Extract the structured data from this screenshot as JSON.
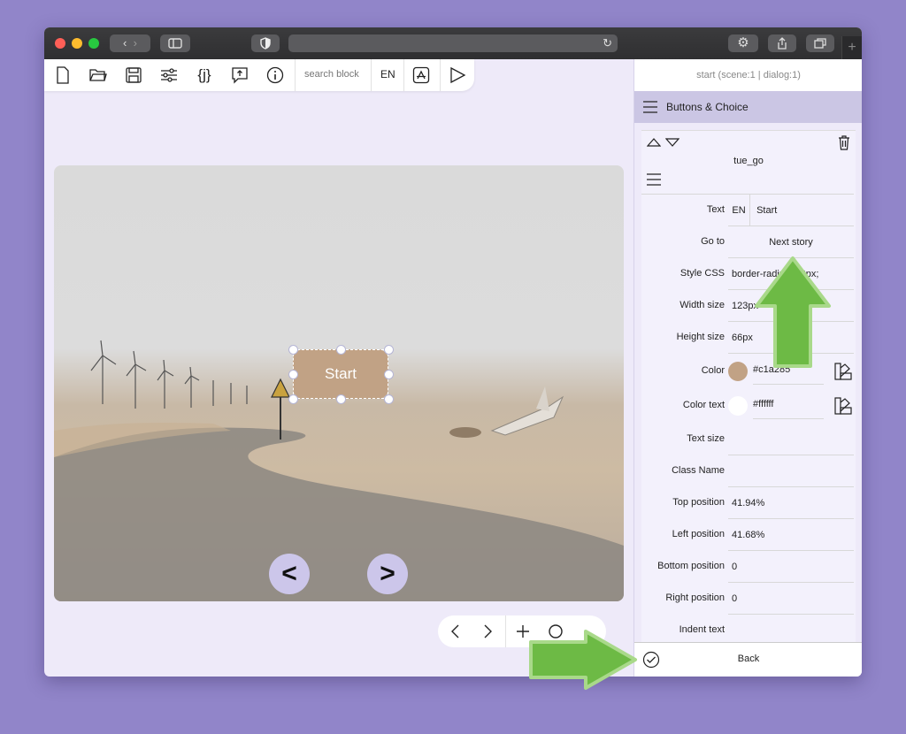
{
  "toolbar": {
    "search_placeholder": "search block",
    "language": "EN"
  },
  "scene": {
    "button_label": "Start",
    "prev_label": "<",
    "next_label": ">"
  },
  "panel": {
    "header": "start (scene:1 | dialog:1)",
    "section_title": "Buttons & Choice",
    "block_name": "tue_go",
    "back_label": "Back",
    "fields": {
      "text_label": "Text",
      "text_lang": "EN",
      "text_value": "Start",
      "goto_label": "Go to",
      "goto_value": "Next story",
      "style_label": "Style CSS",
      "style_value": "border-radius: 12px;",
      "width_label": "Width size",
      "width_value": "123px",
      "height_label": "Height size",
      "height_value": "66px",
      "color_label": "Color",
      "color_value": "#c1a285",
      "color_text_label": "Color text",
      "color_text_value": "#ffffff",
      "text_size_label": "Text size",
      "text_size_value": "",
      "class_label": "Class Name",
      "class_value": "",
      "top_label": "Top position",
      "top_value": "41.94%",
      "left_label": "Left position",
      "left_value": "41.68%",
      "bottom_label": "Bottom position",
      "bottom_value": "0",
      "right_label": "Right position",
      "right_value": "0",
      "indent_label": "Indent text"
    }
  },
  "colors": {
    "accent": "#6dba45",
    "button_bg": "#c1a285",
    "page_bg": "#9185c9"
  }
}
